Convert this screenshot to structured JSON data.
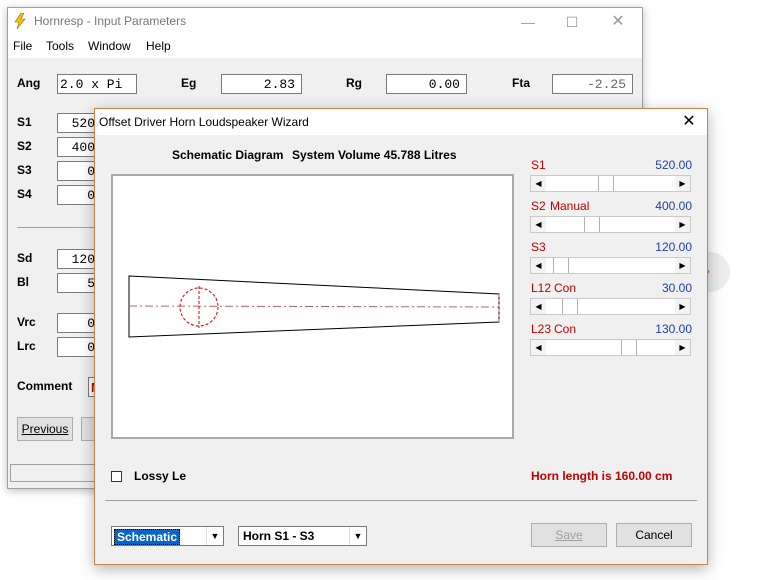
{
  "back_window": {
    "title": "Hornresp - Input Parameters",
    "menu": [
      "File",
      "Tools",
      "Window",
      "Help"
    ],
    "fields": {
      "ang_label": "Ang",
      "ang_value": "2.0 x Pi",
      "eg_label": "Eg",
      "eg_value": "2.83",
      "rg_label": "Rg",
      "rg_value": "0.00",
      "fta_label": "Fta",
      "fta_value": "-2.25",
      "s1_label": "S1",
      "s1_value": "520",
      "s2_label": "S2",
      "s2_value": "400",
      "s3_label": "S3",
      "s3_value": "0",
      "s4_label": "S4",
      "s4_value": "0",
      "sd_label": "Sd",
      "sd_value": "120",
      "bl_label": "Bl",
      "bl_value": "5",
      "vrc_label": "Vrc",
      "vrc_value": "0",
      "lrc_label": "Lrc",
      "lrc_value": "0",
      "comment_label": "Comment",
      "comment_value": "M"
    },
    "previous_button": "Previous"
  },
  "dialog": {
    "title": "Offset Driver Horn Loudspeaker Wizard",
    "schematic_heading": "Schematic Diagram",
    "system_volume": "System Volume 45.788 Litres",
    "params": [
      {
        "name": "S1",
        "mode": "",
        "value": "520.00",
        "level": 0.45
      },
      {
        "name": "S2",
        "mode": "Manual",
        "value": "400.00",
        "level": 0.33
      },
      {
        "name": "S3",
        "mode": "",
        "value": "120.00",
        "level": 0.06
      },
      {
        "name": "L12",
        "mode": "Con",
        "value": "30.00",
        "level": 0.14
      },
      {
        "name": "L23",
        "mode": "Con",
        "value": "130.00",
        "level": 0.65
      }
    ],
    "lossy_le_label": "Lossy Le",
    "horn_length": "Horn length is 160.00 cm",
    "view_select": "Schematic",
    "horn_select": "Horn S1 - S3",
    "save_button": "Save",
    "cancel_button": "Cancel"
  },
  "icons": {
    "app_icon": "lightning-bolt-icon",
    "close": "close-icon"
  }
}
